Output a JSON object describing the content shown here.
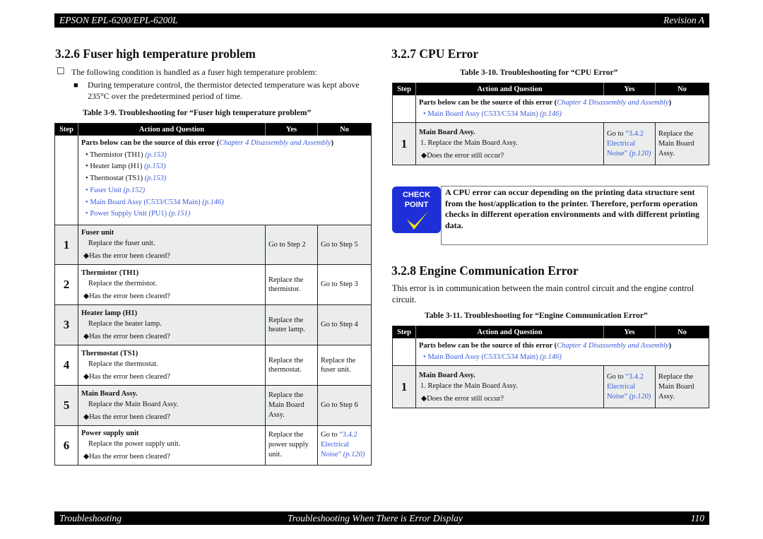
{
  "header": {
    "left": "EPSON EPL-6200/EPL-6200L",
    "right": "Revision A"
  },
  "footer": {
    "left": "Troubleshooting",
    "center": "Troubleshooting When There is Error Display",
    "page": "110"
  },
  "colors": {
    "link": "#3a5bd9",
    "checkpoint_bg": "#1f2fd8",
    "checkmark": "#f5e400",
    "row_grey": "#ebeded"
  },
  "col_headers": {
    "step": "Step",
    "action": "Action and Question",
    "yes": "Yes",
    "no": "No"
  },
  "parts_head": "Parts below can be the source of this error (",
  "parts_link": "Chapter 4 Disassembly and Assembly",
  "parts_close": ")",
  "s326": {
    "title": "3.2.6  Fuser high temperature problem",
    "intro": "The following condition is handled as a fuser high temperature problem:",
    "condition": "During temperature control, the thermistor detected temperature was kept above 235°C over the predetermined period of time.",
    "caption": "Table 3-9.  Troubleshooting for “Fuser high temperature problem”",
    "parts": [
      {
        "name": "Thermistor (TH1) ",
        "page": "(p.153)",
        "name_link": false
      },
      {
        "name": "Heater lamp (H1) ",
        "page": "(p.153)",
        "name_link": false
      },
      {
        "name": "Thermostat (TS1) ",
        "page": "(p.153)",
        "name_link": false
      },
      {
        "name": "Fuser Unit ",
        "page": "(p.152)",
        "name_link": true
      },
      {
        "name": "Main Board Assy (C533/C534 Main) ",
        "page": "(p.146)",
        "name_link": true
      },
      {
        "name": "Power Supply Unit (PU1) ",
        "page": "(p.151)",
        "name_link": true
      }
    ],
    "rows": [
      {
        "step": "1",
        "title": "Fuser unit",
        "action": "Replace the fuser unit.",
        "question": "Has the error been cleared?",
        "yes": "Go to Step 2",
        "no": "Go to Step 5"
      },
      {
        "step": "2",
        "title": "Thermistor (TH1)",
        "action": "Replace the thermistor.",
        "question": "Has the error been cleared?",
        "yes": "Replace the thermistor.",
        "no": "Go to Step 3"
      },
      {
        "step": "3",
        "title": "Heater lamp (H1)",
        "action": "Replace the heater lamp.",
        "question": "Has the error been cleared?",
        "yes": "Replace the heater lamp.",
        "no": "Go to Step 4"
      },
      {
        "step": "4",
        "title": "Thermostat (TS1)",
        "action": "Replace the thermostat.",
        "question": "Has the error been cleared?",
        "yes": "Replace the thermostat.",
        "no": "Replace the fuser unit."
      },
      {
        "step": "5",
        "title": "Main Board Assy.",
        "action": "Replace the Main Board Assy.",
        "question": "Has the error been cleared?",
        "yes": "Replace the Main Board Assy.",
        "no": "Go to Step 6"
      },
      {
        "step": "6",
        "title": "Power supply unit",
        "action": "Replace the power supply unit.",
        "question": "Has the error been cleared?",
        "yes": "Replace the power supply unit.",
        "no_prefix": "Go to ",
        "no_link": "“3.4.2 Electrical Noise”",
        "no_page": " (p.120)"
      }
    ]
  },
  "s327": {
    "title": "3.2.7  CPU Error",
    "caption": "Table 3-10.  Troubleshooting for “CPU Error”",
    "part": {
      "name": "Main Board Assy (C533/C534 Main) ",
      "page": "(p.146)"
    },
    "row": {
      "step": "1",
      "title": "Main Board Assy.",
      "action": "1.  Replace the Main Board Assy.",
      "question": "Does the error still occur?",
      "yes_prefix": "Go to ",
      "yes_link": "“3.4.2 Electrical Noise”",
      "yes_page": "(p.120)",
      "no": "Replace the Main Board Assy."
    },
    "checkpoint": {
      "label1": "CHECK",
      "label2": "POINT",
      "text": "A CPU error can occur depending on the printing data structure sent from the host/application to the printer. Therefore, perform operation checks in different operation environments and with different printing data."
    }
  },
  "s328": {
    "title": "3.2.8  Engine Communication Error",
    "intro": "This error is in communication between the main control circuit and the engine control circuit.",
    "caption": "Table 3-11.  Troubleshooting for “Engine Communication Error”",
    "part": {
      "name": "Main Board Assy (C533/C534 Main) ",
      "page": "(p.146)"
    },
    "row": {
      "step": "1",
      "title": "Main Board Assy.",
      "action": "1.  Replace the Main Board Assy.",
      "question": "Does the error still occur?",
      "yes_prefix": "Go to ",
      "yes_link": "“3.4.2 Electrical Noise”",
      "yes_page": "(p.120)",
      "no": "Replace the Main Board Assy."
    }
  }
}
